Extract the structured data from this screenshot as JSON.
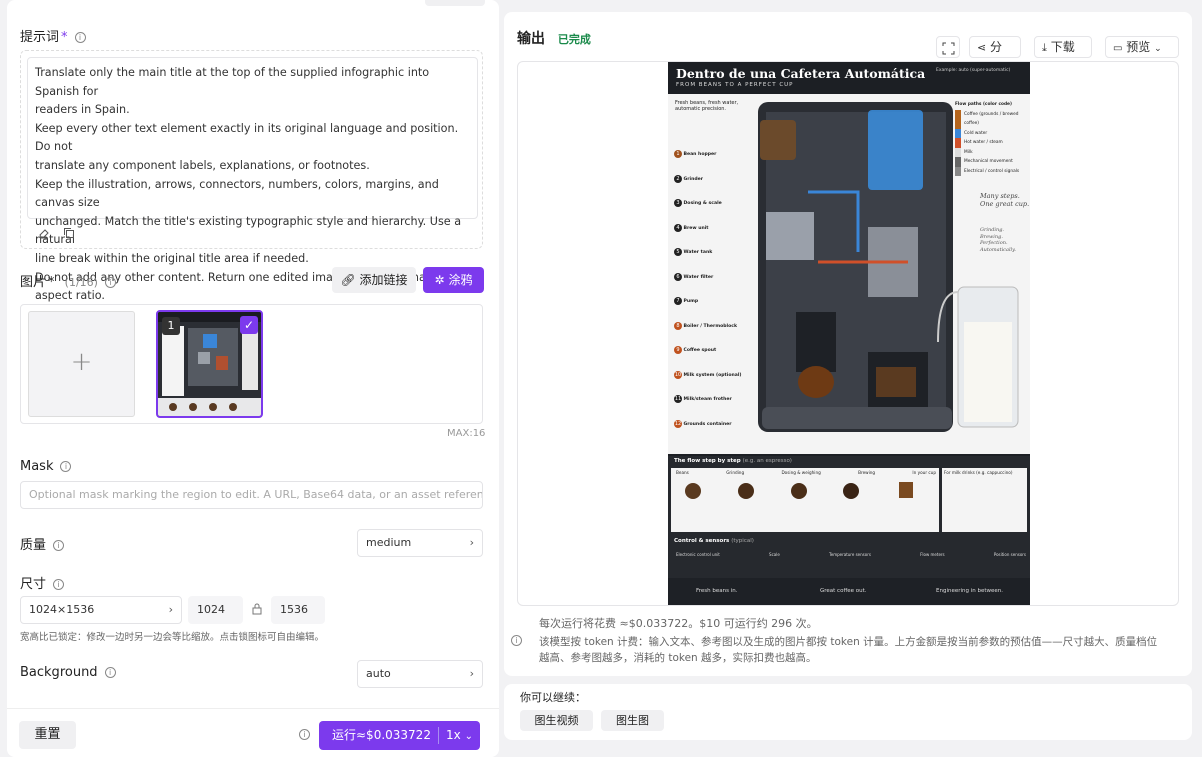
{
  "prompt": {
    "label": "提示词",
    "text_lines": [
      "Translate only the main title at the top of the supplied infographic into Spanish for",
      "readers in Spain.",
      "Keep every other text element exactly in its original language and position. Do not",
      "translate any component labels, explanations, or footnotes.",
      "Keep the illustration, arrows, connectors, numbers, colors, margins, and canvas size",
      "unchanged. Match the title's existing typographic style and hierarchy. Use a natural",
      "line break within the original title area if needed.",
      "Do not add any other content. Return one edited image at the original aspect ratio."
    ]
  },
  "images": {
    "label": "图片",
    "count": "(1/16)",
    "add_link": "添加链接",
    "doodle": "涂鸦",
    "thumb_index": "1",
    "max": "MAX:16"
  },
  "mask": {
    "label": "Mask",
    "placeholder": "Optional mask marking the region to edit. A URL, Base64 data, or an asset reference (asse"
  },
  "quality": {
    "label": "质量",
    "value": "medium"
  },
  "size": {
    "label": "尺寸",
    "preset": "1024×1536",
    "width": "1024",
    "height": "1536",
    "hint": "宽高比已锁定：修改一边时另一边会等比缩放。点击锁图标可自由编辑。"
  },
  "background": {
    "label": "Background",
    "value": "auto"
  },
  "footer": {
    "reset": "重置",
    "run": "运行≈$0.033722",
    "multiplier": "1x"
  },
  "output": {
    "title": "输出",
    "status": "已完成",
    "share": "分享",
    "download": "下载",
    "preview": "预览"
  },
  "infographic": {
    "title": "Dentro de una Cafetera Automática",
    "subtitle": "FROM BEANS TO A PERFECT CUP",
    "example": "Example: auto (super-automatic)",
    "intro": "Fresh beans, fresh water, automatic precision.",
    "parts": [
      "Bean hopper",
      "Grinder",
      "Dosing & scale",
      "Brew unit",
      "Water tank",
      "Water filter",
      "Pump",
      "Boiler / Thermoblock",
      "Coffee spout",
      "Milk system (optional)",
      "Milk/steam frother",
      "Grounds container"
    ],
    "flow_title": "Flow paths (color code)",
    "flows": [
      "Coffee (grounds / brewed coffee)",
      "Cold water",
      "Hot water / steam",
      "Milk",
      "Mechanical movement",
      "Electrical / control signals"
    ],
    "tagline": [
      "Many steps.",
      "One great cup."
    ],
    "tagline2": [
      "Grinding.",
      "Brewing.",
      "Perfection.",
      "Automatically."
    ],
    "steps_title": "The flow step by step",
    "steps_sub": "(e.g. an espresso)",
    "steps": [
      "Beans",
      "Grinding",
      "Dosing & weighing",
      "Brewing",
      "In your cup"
    ],
    "milk_title": "For milk drinks (e.g. cappuccino)",
    "control_title": "Control & sensors",
    "control_sub": "(typical)",
    "controls": [
      "Electronic control unit",
      "Scale",
      "Temperature sensors",
      "Flow meters",
      "Position sensors"
    ],
    "bottom": [
      "Fresh beans in.",
      "Great coffee out.",
      "Engineering in between."
    ]
  },
  "cost": {
    "line1": "每次运行将花费 ≈$0.033722。$10 可运行约 296 次。",
    "line2": "该模型按 token 计费：输入文本、参考图以及生成的图片都按 token 计量。上方金额是按当前参数的预估值——尺寸越大、质量档位",
    "line3": "越高、参考图越多，消耗的 token 越多，实际扣费也越高。"
  },
  "continue": {
    "label": "你可以继续：",
    "video": "图生视频",
    "image": "图生图"
  },
  "colors": {
    "accent": "#7c3aed",
    "success": "#1a8a4a"
  }
}
